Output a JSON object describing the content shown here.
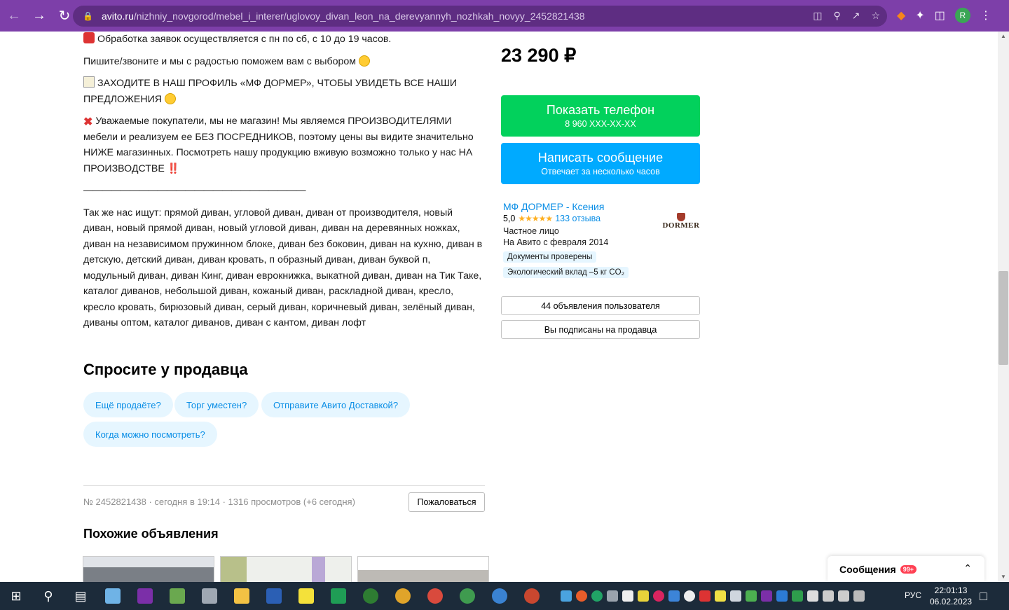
{
  "browser": {
    "url_host": "avito.ru",
    "url_path": "/nizhniy_novgorod/mebel_i_interer/uglovoy_divan_leon_na_derevyannyh_nozhkah_novyy_2452821438",
    "avatar_letter": "R"
  },
  "description": {
    "hours": "Обработка заявок осуществляется с пн по сб, с 10 до 19 часов.",
    "call": "Пишите/звоните и мы с радостью поможем вам с выбором",
    "profile": "ЗАХОДИТЕ В НАШ ПРОФИЛЬ «МФ ДОРМЕР», ЧТОБЫ УВИДЕТЬ ВСЕ НАШИ ПРЕДЛОЖЕНИЯ",
    "notice": "Уважаемые покупатели, мы не магазин! Мы являемся ПРОИЗВОДИТЕЛЯМИ мебели и реализуем ее БЕЗ ПОСРЕДНИКОВ, поэтому цены вы видите значительно НИЖЕ магазинных. Посмотреть нашу продукцию вживую возможно только у нас НА ПРОИЗВОДСТВЕ ‼️",
    "divider": "————————————————————————",
    "keywords": "Так же нас ищут: прямой диван, угловой диван, диван от производителя, новый диван, новый прямой диван, новый угловой диван, диван на деревянных ножках, диван на независимом пружинном блоке, диван без боковин, диван на кухню, диван в детскую, детский диван, диван кровать, п образный диван, диван буквой п, модульный диван, диван Кинг, диван еврокнижка, выкатной диван, диван на Тик Таке, каталог диванов, небольшой диван, кожаный диван, раскладной диван, кресло, кресло кровать, бирюзовый диван, серый диван, коричневый диван, зелёный диван, диваны оптом, каталог диванов, диван с кантом, диван лофт"
  },
  "ask": {
    "title": "Спросите у продавца",
    "chips": [
      "Ещё продаёте?",
      "Торг уместен?",
      "Отправите Авито Доставкой?",
      "Когда можно посмотреть?"
    ]
  },
  "listing": {
    "meta": "№ 2452821438 · сегодня в 19:14 · 1316 просмотров (+6 сегодня)",
    "complain": "Пожаловаться",
    "similar_title": "Похожие объявления"
  },
  "sidebar": {
    "price": "23 290 ₽",
    "phone_title": "Показать телефон",
    "phone_number": "8 960 XXX-XX-XX",
    "msg_title": "Написать сообщение",
    "msg_sub": "Отвечает за несколько часов",
    "seller_name": "МФ ДОРМЕР - Ксения",
    "rating": "5,0",
    "stars": "★★★★★",
    "reviews": "133 отзыва",
    "seller_type": "Частное лицо",
    "since": "На Авито с февраля 2014",
    "badge_docs": "Документы проверены",
    "badge_eco": "Экологический вклад –5 кг CO₂",
    "logo_text": "DORMER",
    "listings_btn": "44 объявления пользователя",
    "subscribed_btn": "Вы подписаны на продавца"
  },
  "messages": {
    "label": "Сообщения",
    "count": "99+"
  },
  "taskbar": {
    "lang": "РУС",
    "time": "22:01:13",
    "date": "06.02.2023"
  }
}
